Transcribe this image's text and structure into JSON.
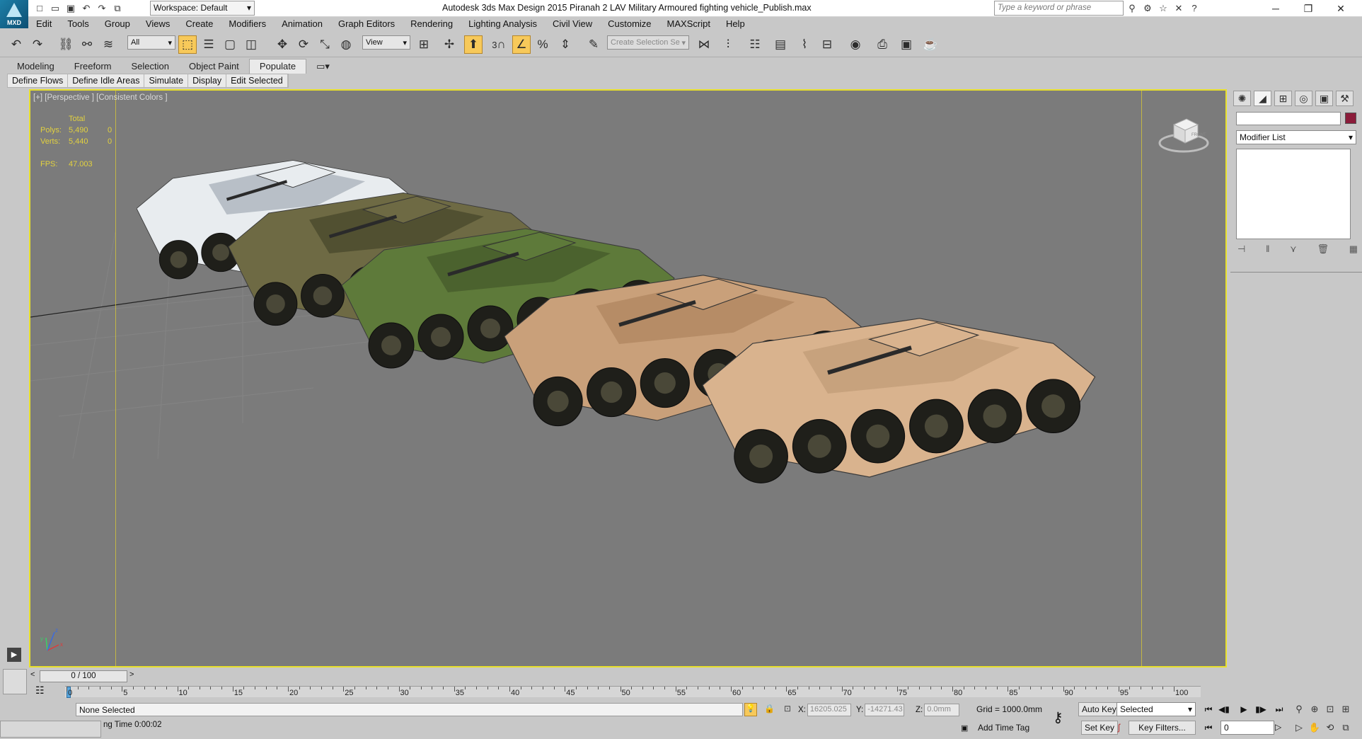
{
  "app": {
    "logo_text": "MXD",
    "workspace": "Workspace: Default",
    "title": "Autodesk 3ds Max Design 2015     Piranah 2 LAV Military Armoured fighting vehicle_Publish.max",
    "search_placeholder": "Type a keyword or phrase"
  },
  "menu": [
    "Edit",
    "Tools",
    "Group",
    "Views",
    "Create",
    "Modifiers",
    "Animation",
    "Graph Editors",
    "Rendering",
    "Lighting Analysis",
    "Civil View",
    "Customize",
    "MAXScript",
    "Help"
  ],
  "toolbar": {
    "selection_filter": "All",
    "ref_coord": "View",
    "snap_label": "3",
    "named_selection_placeholder": "Create Selection Se"
  },
  "ribbon": {
    "tabs": [
      "Modeling",
      "Freeform",
      "Selection",
      "Object Paint",
      "Populate"
    ],
    "active_tab": "Populate",
    "sub_items": [
      "Define Flows",
      "Define Idle Areas",
      "Simulate",
      "Display",
      "Edit Selected"
    ]
  },
  "viewport": {
    "label": "[+] [Perspective ] [Consistent Colors ]",
    "stats": {
      "header": "Total",
      "polys_label": "Polys:",
      "polys_total": "5,490",
      "polys_sel": "0",
      "verts_label": "Verts:",
      "verts_total": "5,440",
      "verts_sel": "0",
      "fps_label": "FPS:",
      "fps_value": "47.003"
    },
    "viewcube_label": "FRONT",
    "vehicle_camos": [
      "#e8ecef",
      "#6e6a44",
      "#5e7a3a",
      "#c9a07a",
      "#d9b38e"
    ],
    "axis": {
      "x": "x",
      "y": "y",
      "z": "z"
    }
  },
  "command_panel": {
    "modifier_list": "Modifier List",
    "color_swatch": "#8b1c3a"
  },
  "timeline": {
    "frame_slider": "0 / 100",
    "ticks": [
      "0",
      "5",
      "10",
      "15",
      "20",
      "25",
      "30",
      "35",
      "40",
      "45",
      "50",
      "55",
      "60",
      "65",
      "70",
      "75",
      "80",
      "85",
      "90",
      "95",
      "100"
    ]
  },
  "status": {
    "selection": "None Selected",
    "render_time": "ng Time  0:00:02",
    "x_label": "X:",
    "x_value": "16205.025",
    "y_label": "Y:",
    "y_value": "-14271.43",
    "z_label": "Z:",
    "z_value": "0.0mm",
    "grid": "Grid = 1000.0mm",
    "add_time_tag": "Add Time Tag",
    "auto_key": "Auto Key",
    "set_key": "Set Key",
    "key_mode": "Selected",
    "key_filters": "Key Filters...",
    "current_frame": "0"
  }
}
